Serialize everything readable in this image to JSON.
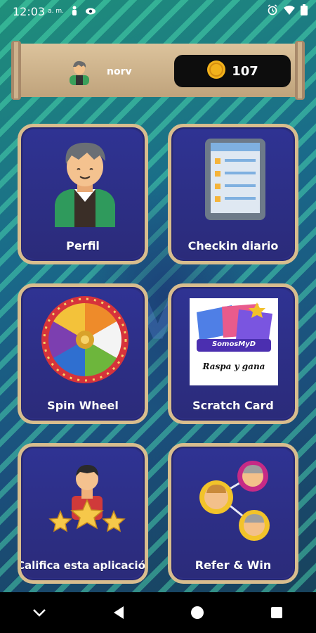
{
  "status_bar": {
    "time": "12:03",
    "ampm": "a. m."
  },
  "header": {
    "username": "norv",
    "coins": "107"
  },
  "cards": [
    {
      "label": "Perfil"
    },
    {
      "label": "Checkin diario"
    },
    {
      "label": "Spin Wheel"
    },
    {
      "label": "Scratch Card"
    },
    {
      "label": "Califica esta aplicación"
    },
    {
      "label": "Refer & Win"
    }
  ],
  "scratch_image": {
    "brand": "SomosMyD",
    "caption": "Raspa y gana"
  },
  "colors": {
    "card_bg": "#2e2f86",
    "card_border": "#d8bd8e",
    "scroll": "#cdb28c",
    "coin": "#f2b21b"
  }
}
